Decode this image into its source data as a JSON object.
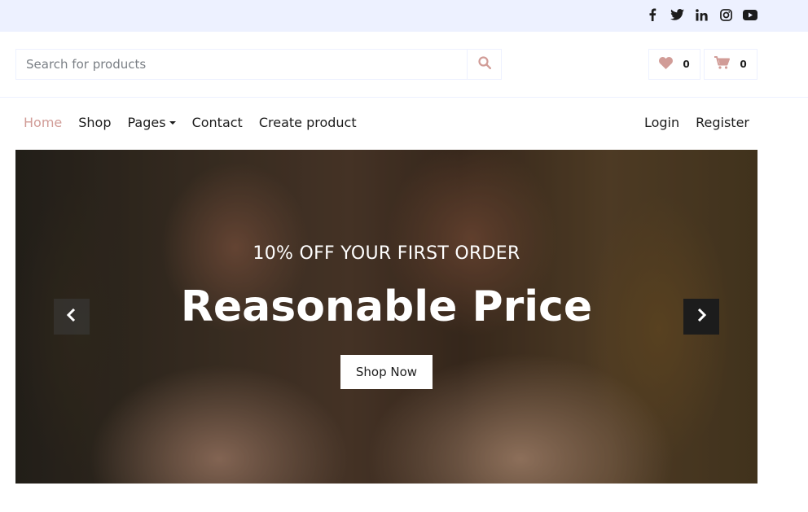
{
  "topbar": {
    "social_icons": [
      "facebook-icon",
      "twitter-icon",
      "linkedin-icon",
      "instagram-icon",
      "youtube-icon"
    ]
  },
  "search": {
    "placeholder": "Search for products",
    "icon": "search-icon"
  },
  "header_actions": {
    "wishlist_icon": "heart-icon",
    "wishlist_count": "0",
    "cart_icon": "cart-icon",
    "cart_count": "0"
  },
  "nav": {
    "items": [
      {
        "label": "Home",
        "active": true
      },
      {
        "label": "Shop",
        "active": false
      },
      {
        "label": "Pages",
        "active": false,
        "dropdown": true
      },
      {
        "label": "Contact",
        "active": false
      },
      {
        "label": "Create product",
        "active": false
      }
    ],
    "login": "Login",
    "register": "Register"
  },
  "hero": {
    "subtitle": "10% OFF YOUR FIRST ORDER",
    "title": "Reasonable Price",
    "button": "Shop Now",
    "prev_icon": "chevron-left-icon",
    "next_icon": "chevron-right-icon"
  },
  "colors": {
    "accent": "#d19c97",
    "topbar_bg": "#edf1ff",
    "text": "#1c1c1c"
  }
}
